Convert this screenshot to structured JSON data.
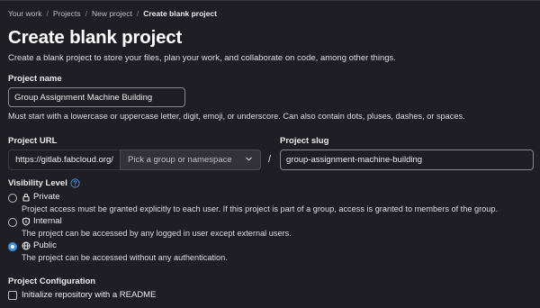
{
  "breadcrumb": {
    "items": [
      "Your work",
      "Projects",
      "New project"
    ],
    "current": "Create blank project",
    "separator": "/"
  },
  "page": {
    "title": "Create blank project",
    "description": "Create a blank project to store your files, plan your work, and collaborate on code, among other things."
  },
  "project_name": {
    "label": "Project name",
    "value": "Group Assignment Machine Building",
    "help": "Must start with a lowercase or uppercase letter, digit, emoji, or underscore. Can also contain dots, pluses, dashes, or spaces."
  },
  "project_url": {
    "label": "Project URL",
    "prefix": "https://gitlab.fabcloud.org/",
    "namespace_placeholder": "Pick a group or namespace"
  },
  "project_slug": {
    "label": "Project slug",
    "value": "group-assignment-machine-building"
  },
  "visibility": {
    "label": "Visibility Level",
    "options": [
      {
        "label": "Private",
        "icon": "lock-icon",
        "description": "Project access must be granted explicitly to each user. If this project is part of a group, access is granted to members of the group.",
        "selected": false
      },
      {
        "label": "Internal",
        "icon": "shield-icon",
        "description": "The project can be accessed by any logged in user except external users.",
        "selected": false
      },
      {
        "label": "Public",
        "icon": "globe-icon",
        "description": "The project can be accessed without any authentication.",
        "selected": true
      }
    ]
  },
  "configuration": {
    "label": "Project Configuration",
    "readme_label": "Initialize repository with a README",
    "readme_checked": false
  },
  "colors": {
    "background": "#1f1e24",
    "accent": "#428fdc",
    "border": "#89888d"
  }
}
